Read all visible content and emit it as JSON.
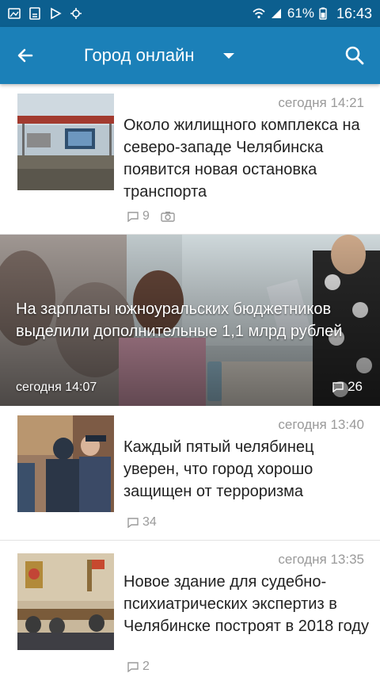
{
  "status_bar": {
    "battery": "61%",
    "time": "16:43"
  },
  "app_bar": {
    "title": "Город онлайн"
  },
  "articles": [
    {
      "time": "сегодня 14:21",
      "headline": "Около жилищного комплекса на северо-западе Челябинска появится новая остановка транспорта",
      "comments": "9"
    },
    {
      "time": "сегодня 14:07",
      "headline": "На зарплаты южноуральских бюджетников выделили дополнительные 1,1 млрд рублей",
      "comments": "26"
    },
    {
      "time": "сегодня 13:40",
      "headline": "Каждый пятый челябинец уверен, что город хорошо защищен от терроризма",
      "comments": "34"
    },
    {
      "time": "сегодня 13:35",
      "headline": "Новое здание для судебно-психиатрических экспертиз в Челябинске построят в 2018 году",
      "comments": "2"
    }
  ]
}
